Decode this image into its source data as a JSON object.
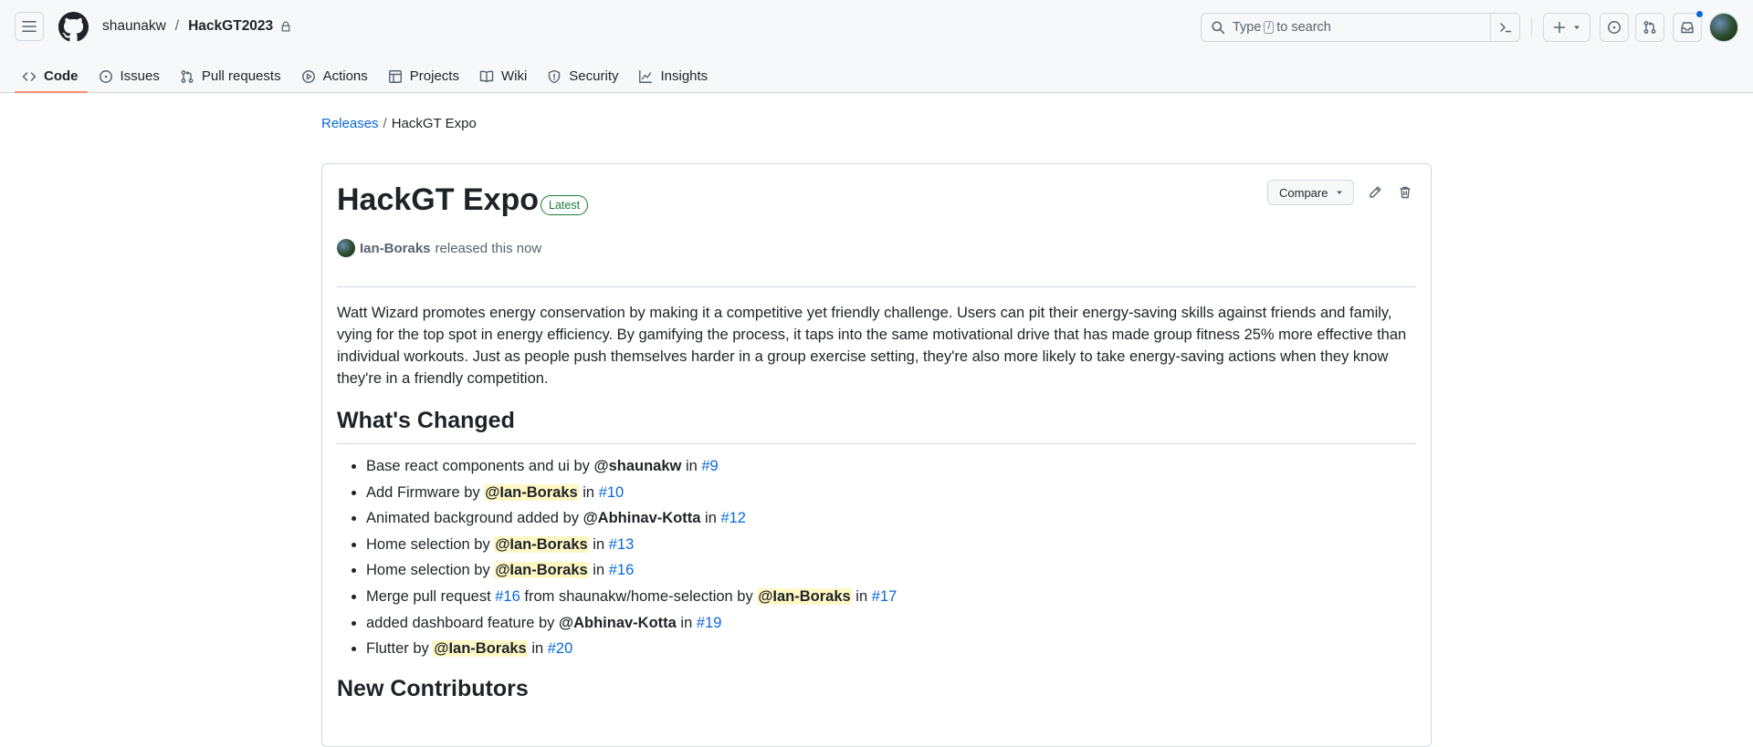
{
  "header": {
    "owner": "shaunakw",
    "repo": "HackGT2023",
    "search_prefix": "Type",
    "search_key": "/",
    "search_suffix": "to search"
  },
  "tabs": [
    {
      "label": "Code",
      "icon": "code-icon",
      "active": true
    },
    {
      "label": "Issues",
      "icon": "issue-icon"
    },
    {
      "label": "Pull requests",
      "icon": "pull-request-icon"
    },
    {
      "label": "Actions",
      "icon": "play-icon"
    },
    {
      "label": "Projects",
      "icon": "table-icon"
    },
    {
      "label": "Wiki",
      "icon": "book-icon"
    },
    {
      "label": "Security",
      "icon": "shield-icon"
    },
    {
      "label": "Insights",
      "icon": "graph-icon"
    }
  ],
  "breadcrumb": {
    "releases": "Releases",
    "sep": "/",
    "current": "HackGT Expo"
  },
  "release": {
    "title": "HackGT Expo",
    "badge": "Latest",
    "compare_label": "Compare",
    "author": "Ian-Boraks",
    "released_text": "released this now",
    "description": "Watt Wizard promotes energy conservation by making it a competitive yet friendly challenge. Users can pit their energy-saving skills against friends and family, vying for the top spot in energy efficiency. By gamifying the process, it taps into the same motivational drive that has made group fitness 25% more effective than individual workouts. Just as people push themselves harder in a group exercise setting, they're also more likely to take energy-saving actions when they know they're in a friendly competition.",
    "changes_heading": "What's Changed",
    "changes": [
      {
        "pre": "Base react components and ui by ",
        "user": "@shaunakw",
        "mid": " in ",
        "pr": "#9",
        "highlight": false
      },
      {
        "pre": "Add Firmware by ",
        "user": "@Ian-Boraks",
        "mid": " in ",
        "pr": "#10",
        "highlight": true
      },
      {
        "pre": "Animated background added by ",
        "user": "@Abhinav-Kotta",
        "mid": " in ",
        "pr": "#12",
        "highlight": false
      },
      {
        "pre": "Home selection by ",
        "user": "@Ian-Boraks",
        "mid": " in ",
        "pr": "#13",
        "highlight": true
      },
      {
        "pre": "Home selection by ",
        "user": "@Ian-Boraks",
        "mid": " in ",
        "pr": "#16",
        "highlight": true
      },
      {
        "pre": "Merge pull request ",
        "pre_link": "#16",
        "pre2": " from shaunakw/home-selection by ",
        "user": "@Ian-Boraks",
        "mid": " in ",
        "pr": "#17",
        "highlight": true
      },
      {
        "pre": "added dashboard feature by ",
        "user": "@Abhinav-Kotta",
        "mid": " in ",
        "pr": "#19",
        "highlight": false
      },
      {
        "pre": "Flutter by ",
        "user": "@Ian-Boraks",
        "mid": " in ",
        "pr": "#20",
        "highlight": true
      }
    ],
    "contributors_heading": "New Contributors"
  },
  "colors": {
    "link": "#0969da",
    "tab_underline": "#fd8c73",
    "latest_green": "#1a7f37",
    "mention_highlight": "#fff8c5"
  }
}
